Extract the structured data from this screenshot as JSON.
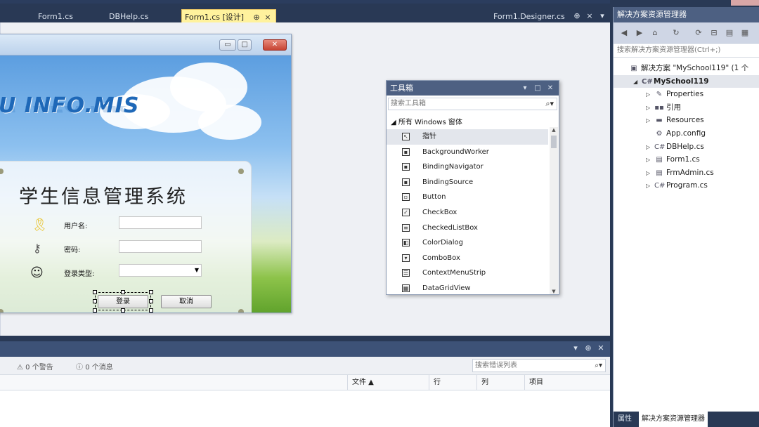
{
  "tabs": [
    {
      "label": "Form1.cs",
      "active": false
    },
    {
      "label": "DBHelp.cs",
      "active": false
    },
    {
      "label": "Form1.cs [设计]",
      "active": true
    },
    {
      "label": "Form1.Designer.cs",
      "active": false
    }
  ],
  "tab_icons": {
    "pin": "⊕",
    "close": "×",
    "dropdown": "▾"
  },
  "form": {
    "brand": "U INFO.MIS",
    "title": "学生信息管理系统",
    "username_label": "用户名:",
    "password_label": "密码:",
    "login_type_label": "登录类型:",
    "login_button": "登录",
    "cancel_button": "取消"
  },
  "toolbox": {
    "title": "工具箱",
    "search_placeholder": "搜索工具箱",
    "group": "所有 Windows 窗体",
    "items": [
      {
        "label": "指针",
        "icon": "pointer-icon",
        "glyph": "↖",
        "selected": true
      },
      {
        "label": "BackgroundWorker",
        "icon": "backgroundworker-icon",
        "glyph": "▪",
        "selected": false
      },
      {
        "label": "BindingNavigator",
        "icon": "bindingnavigator-icon",
        "glyph": "▪",
        "selected": false
      },
      {
        "label": "BindingSource",
        "icon": "bindingsource-icon",
        "glyph": "▪",
        "selected": false
      },
      {
        "label": "Button",
        "icon": "button-icon",
        "glyph": "▫",
        "selected": false
      },
      {
        "label": "CheckBox",
        "icon": "checkbox-icon",
        "glyph": "✓",
        "selected": false
      },
      {
        "label": "CheckedListBox",
        "icon": "checkedlistbox-icon",
        "glyph": "≡",
        "selected": false
      },
      {
        "label": "ColorDialog",
        "icon": "colordialog-icon",
        "glyph": "◧",
        "selected": false
      },
      {
        "label": "ComboBox",
        "icon": "combobox-icon",
        "glyph": "▾",
        "selected": false
      },
      {
        "label": "ContextMenuStrip",
        "icon": "contextmenustrip-icon",
        "glyph": "☰",
        "selected": false
      },
      {
        "label": "DataGridView",
        "icon": "datagridview-icon",
        "glyph": "▦",
        "selected": false
      }
    ]
  },
  "error_list": {
    "warnings": "0 个警告",
    "messages": "0 个消息",
    "search_placeholder": "搜索错误列表",
    "columns": [
      "文件 ▲",
      "行",
      "列",
      "项目"
    ]
  },
  "solution_explorer": {
    "title": "解决方案资源管理器",
    "search_placeholder": "搜索解决方案资源管理器(Ctrl+;)",
    "nodes": [
      {
        "label": "解决方案 \"MySchool119\" (1 个",
        "icon": "solution-icon",
        "glyph": "▣",
        "indent": 0,
        "expander": "",
        "bold": false,
        "highlight": false
      },
      {
        "label": "MySchool119",
        "icon": "csharp-project-icon",
        "glyph": "C#",
        "indent": 1,
        "expander": "◢",
        "bold": true,
        "highlight": true
      },
      {
        "label": "Properties",
        "icon": "wrench-icon",
        "glyph": "✎",
        "indent": 2,
        "expander": "▷",
        "bold": false,
        "highlight": false
      },
      {
        "label": "引用",
        "icon": "references-icon",
        "glyph": "▪▪",
        "indent": 2,
        "expander": "▷",
        "bold": false,
        "highlight": false
      },
      {
        "label": "Resources",
        "icon": "folder-icon",
        "glyph": "▬",
        "indent": 2,
        "expander": "▷",
        "bold": false,
        "highlight": false
      },
      {
        "label": "App.config",
        "icon": "config-icon",
        "glyph": "⚙",
        "indent": 2,
        "expander": "",
        "bold": false,
        "highlight": false
      },
      {
        "label": "DBHelp.cs",
        "icon": "csharp-file-icon",
        "glyph": "C#",
        "indent": 2,
        "expander": "▷",
        "bold": false,
        "highlight": false
      },
      {
        "label": "Form1.cs",
        "icon": "form-icon",
        "glyph": "▤",
        "indent": 2,
        "expander": "▷",
        "bold": false,
        "highlight": false
      },
      {
        "label": "FrmAdmin.cs",
        "icon": "form-icon",
        "glyph": "▤",
        "indent": 2,
        "expander": "▷",
        "bold": false,
        "highlight": false
      },
      {
        "label": "Program.cs",
        "icon": "csharp-file-icon",
        "glyph": "C#",
        "indent": 2,
        "expander": "▷",
        "bold": false,
        "highlight": false
      }
    ],
    "bottom_tabs": [
      "属性",
      "解决方案资源管理器"
    ]
  },
  "colors": {
    "vs_chrome": "#293955",
    "active_tab": "#fff29d",
    "title_bar": "#4d6082"
  }
}
